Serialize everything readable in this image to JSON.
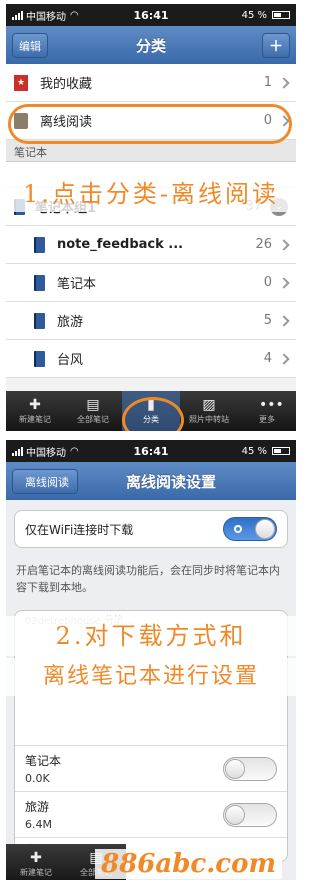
{
  "screen1": {
    "status": {
      "carrier": "中国移动",
      "time": "16:41",
      "battery": "45 %"
    },
    "nav": {
      "title": "分类",
      "edit_label": "编辑"
    },
    "favorites": {
      "label": "我的收藏",
      "count": "1"
    },
    "offline": {
      "label": "离线阅读",
      "count": "0"
    },
    "section_notebooks": "笔记本",
    "group": {
      "label": "笔记本组1",
      "count": "37"
    },
    "notebooks": [
      {
        "label": "note_feedback ...",
        "count": "26"
      },
      {
        "label": "笔记本",
        "count": "0"
      },
      {
        "label": "旅游",
        "count": "5"
      },
      {
        "label": "台风",
        "count": "4"
      }
    ],
    "tabs": [
      {
        "label": "新建笔记",
        "icon": "plus-icon"
      },
      {
        "label": "全部笔记",
        "icon": "notes-icon"
      },
      {
        "label": "分类",
        "icon": "category-icon"
      },
      {
        "label": "照片中转站",
        "icon": "photo-icon"
      },
      {
        "label": "更多",
        "icon": "more-icon"
      }
    ],
    "annotation": "1.点击分类-离线阅读",
    "highlight_color": "#f08a28"
  },
  "screen2": {
    "status": {
      "carrier": "中国移动",
      "time": "16:41",
      "battery": "45 %"
    },
    "nav": {
      "title": "离线阅读设置",
      "back_label": "离线阅读"
    },
    "wifi_only": {
      "label": "仅在WiFi连接时下载",
      "enabled": true
    },
    "hint": "开启笔记本的离线阅读功能后，会在同步时将笔记本内容下载到本地。",
    "ghost_row": "02detrebhouse 分笔...",
    "annotation_line1": "2.对下载方式和",
    "annotation_line2": "离线笔记本进行设置",
    "notebooks": [
      {
        "name": "笔记本",
        "size": "0.0K"
      },
      {
        "name": "旅游",
        "size": "6.4M"
      },
      {
        "name": "台风",
        "size": ""
      }
    ],
    "tabs": [
      {
        "label": "新建笔记",
        "icon": "plus-icon"
      },
      {
        "label": "全部笔记",
        "icon": "notes-icon"
      }
    ],
    "watermark": "886abc.com"
  }
}
